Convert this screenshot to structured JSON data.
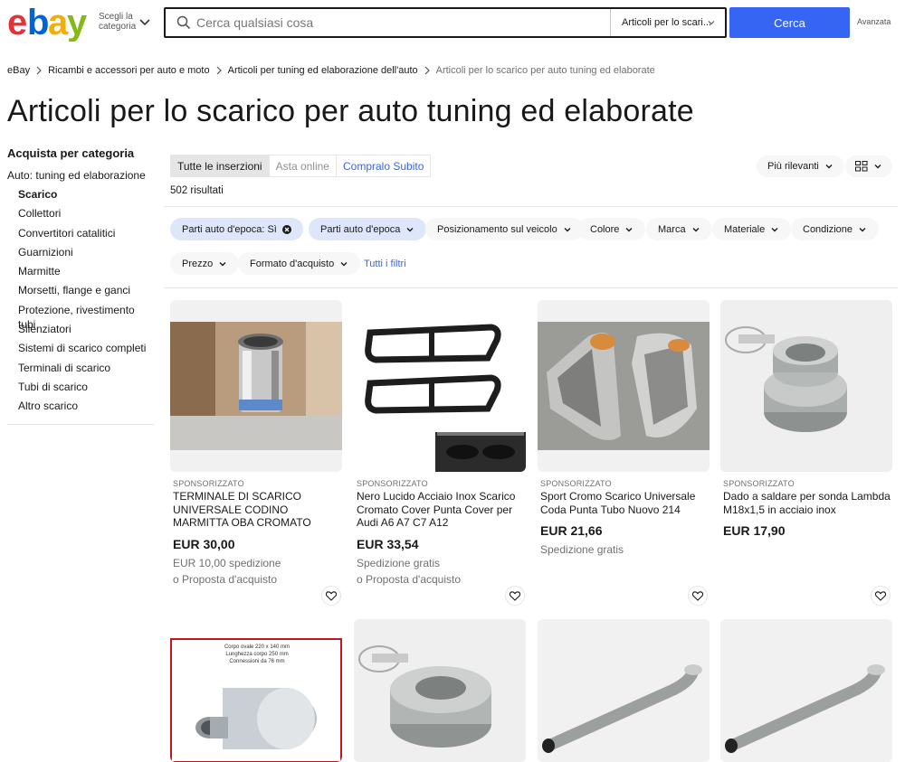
{
  "header": {
    "logo_letters": [
      "e",
      "b",
      "a",
      "y"
    ],
    "logo_colors": [
      "#e53238",
      "#0064d2",
      "#f5af02",
      "#86b817"
    ],
    "shop_by_category": "Scegli la categoria",
    "search_placeholder": "Cerca qualsiasi cosa",
    "category_select": "Articoli per lo scari...",
    "search_button": "Cerca",
    "advanced": "Avanzata",
    "accent_color": "#3665f3"
  },
  "breadcrumb": [
    {
      "label": "eBay"
    },
    {
      "label": "Ricambi e accessori per auto e moto"
    },
    {
      "label": "Articoli per tuning ed elaborazione dell'auto"
    },
    {
      "label": "Articoli per lo scarico per auto tuning ed elaborate"
    }
  ],
  "page_title": "Articoli per lo scarico per auto tuning ed elaborate",
  "sidebar": {
    "heading": "Acquista per categoria",
    "parent": "Auto: tuning ed elaborazione",
    "items": [
      "Scarico",
      "Collettori",
      "Convertitori catalitici",
      "Guarnizioni",
      "Marmitte",
      "Morsetti, flange e ganci",
      "Protezione, rivestimento tubi",
      "Silenziatori",
      "Sistemi di scarico completi",
      "Terminali di scarico",
      "Tubi di scarico",
      "Altro scarico"
    ],
    "active_item": "Scarico"
  },
  "tabs": [
    "Tutte le inserzioni",
    "Asta online",
    "Compralo Subito"
  ],
  "results_count": "502 risultati",
  "sort_label": "Più rilevanti",
  "filters": {
    "row1": [
      "Parti auto d'epoca: Sì",
      "Parti auto d'epoca",
      "Posizionamento sul veicolo",
      "Colore",
      "Marca",
      "Materiale",
      "Condizione"
    ],
    "row2": [
      "Prezzo",
      "Formato d'acquisto"
    ],
    "all_filters": "Tutti i filtri"
  },
  "products": [
    {
      "sponsored": "SPONSORIZZATO",
      "title": "TERMINALE DI SCARICO UNIVERSALE CODINO MARMITTA OBA CROMATO ATTACCO FINO ...",
      "price": "EUR 30,00",
      "shipping": "EUR 10,00 spedizione",
      "offer": "o Proposta d'acquisto"
    },
    {
      "sponsored": "SPONSORIZZATO",
      "title": "Nero Lucido Acciaio Inox Scarico Cromato Cover Punta Cover per Audi A6 A7 C7 A12",
      "price": "EUR 33,54",
      "shipping": "Spedizione gratis",
      "offer": "o Proposta d'acquisto"
    },
    {
      "sponsored": "SPONSORIZZATO",
      "title": "Sport Cromo Scarico Universale Coda Punta Tubo Nuovo 214",
      "price": "EUR 21,66",
      "shipping": "Spedizione gratis",
      "offer": ""
    },
    {
      "sponsored": "SPONSORIZZATO",
      "title": "Dado a saldare per sonda Lambda M18x1,5 in acciaio inox",
      "price": "EUR 17,90",
      "shipping": "",
      "offer": ""
    }
  ],
  "product_row2_labels": {
    "muffler_text_1": "Corpo ovale 220 x 140 mm",
    "muffler_text_2": "Lunghezza corpo 250 mm",
    "muffler_text_3": "Connessioni da 76 mm"
  }
}
